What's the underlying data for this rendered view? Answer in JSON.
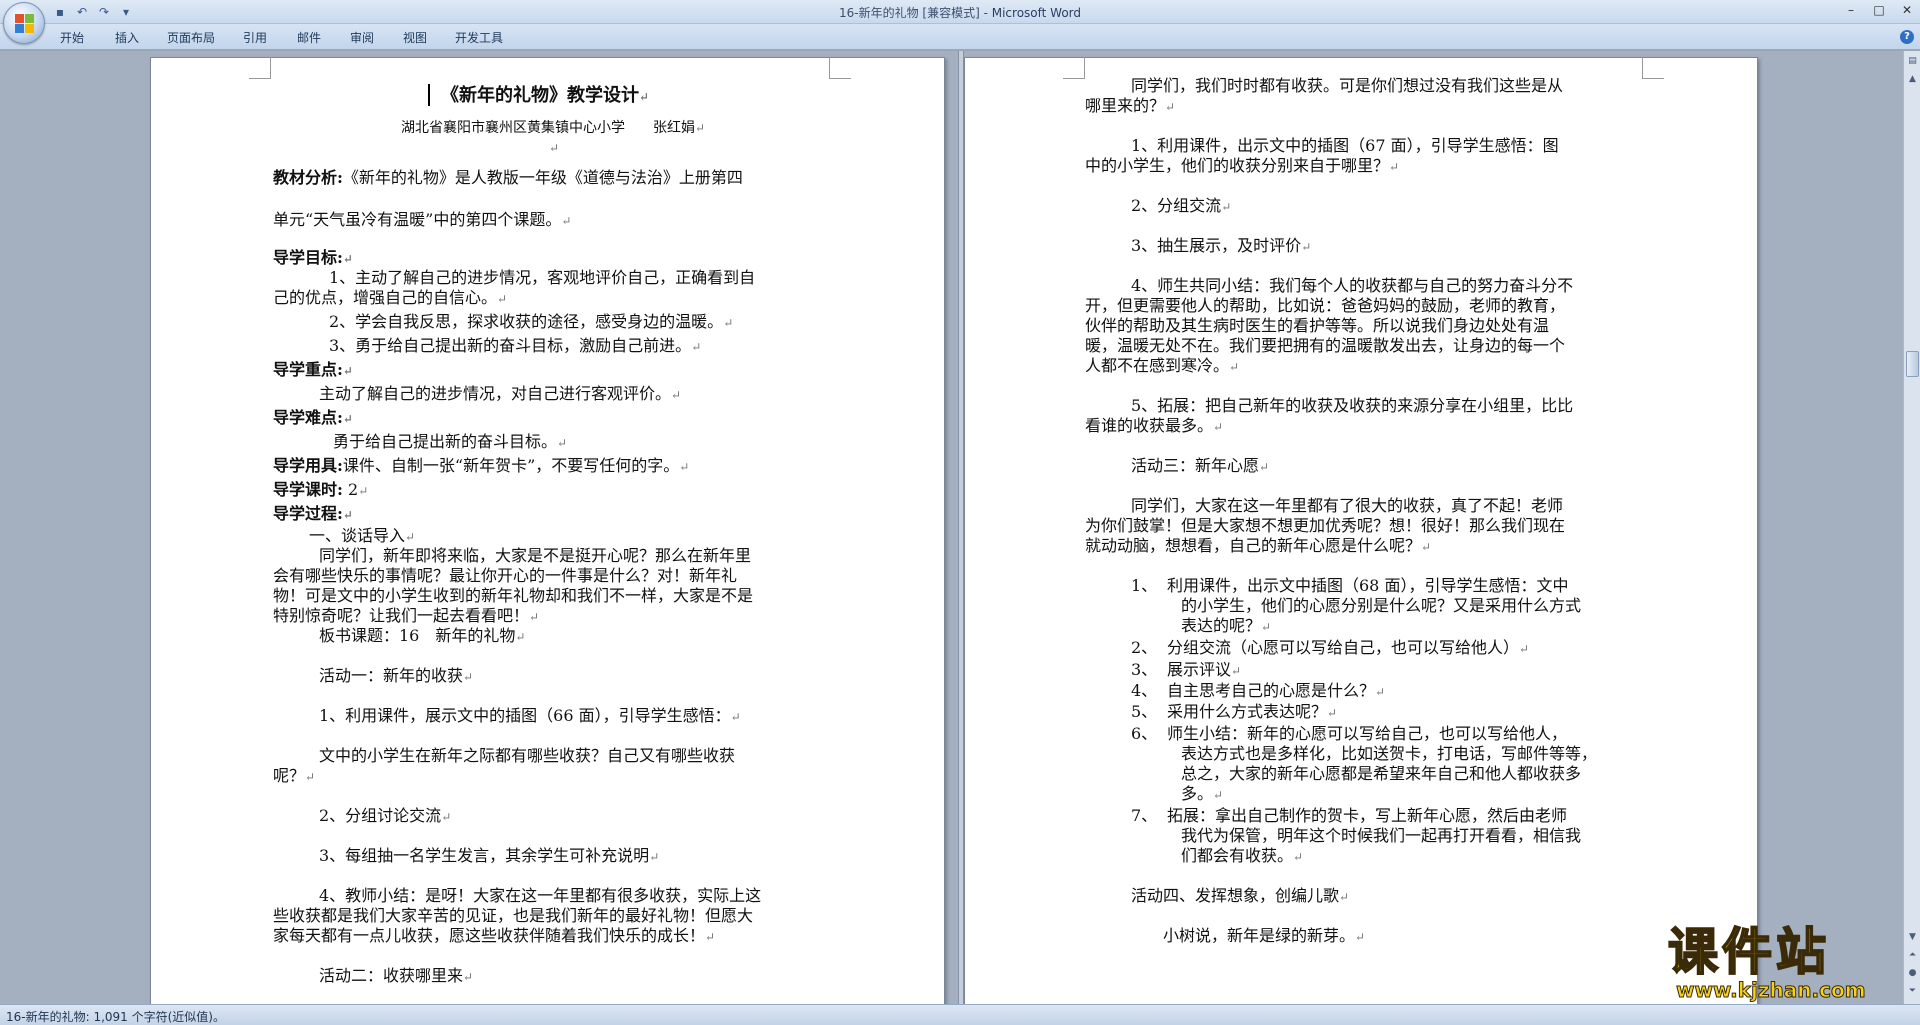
{
  "window": {
    "title": "16-新年的礼物 [兼容模式]",
    "app_name": "Microsoft Word",
    "title_separator": " - "
  },
  "quick_access": {
    "icons": [
      "save-icon",
      "undo-icon",
      "redo-icon",
      "customize-icon"
    ]
  },
  "ribbon_tabs": [
    "开始",
    "插入",
    "页面布局",
    "引用",
    "邮件",
    "审阅",
    "视图",
    "开发工具"
  ],
  "left_page": {
    "title": "《新年的礼物》教学设计",
    "author": "湖北省襄阳市襄州区黄集镇中心小学　　张红娟",
    "analysis_label": "教材分析:",
    "analysis_line1": "《新年的礼物》是人教版一年级《道德与法治》上册第四",
    "analysis_line2": "单元“天气虽冷有温暖”中的第四个课题。",
    "goals_label": "导学目标:",
    "goal1_a": "1、主动了解自己的进步情况，客观地评价自己，正确看到自",
    "goal1_b": "己的优点，增强自己的自信心。",
    "goal2": "2、学会自我反思，探求收获的途径，感受身边的温暖。",
    "goal3": "3、勇于给自己提出新的奋斗目标，激励自己前进。",
    "key_label": "导学重点:",
    "key_text": "主动了解自己的进步情况，对自己进行客观评价。",
    "hard_label": "导学难点:",
    "hard_text": "勇于给自己提出新的奋斗目标。",
    "tools_label": "导学用具:",
    "tools_text": "课件、自制一张“新年贺卡”，不要写任何的字。",
    "hours_label": "导学课时:",
    "hours_text": "2",
    "process_label": "导学过程:",
    "intro_head": "一、谈话导入",
    "intro_p1": "同学们，新年即将来临，大家是不是挺开心呢？那么在新年里",
    "intro_p2": "会有哪些快乐的事情呢？最让你开心的一件事是什么？对！新年礼",
    "intro_p3": "物！可是文中的小学生收到的新年礼物却和我们不一样，大家是不是",
    "intro_p4": "特别惊奇呢？让我们一起去看看吧！",
    "board": "板书课题：16　新年的礼物",
    "act1": "活动一：新年的收获",
    "act1_s1": "1、利用课件，展示文中的插图（66 面），引导学生感悟：",
    "act1_q1": "文中的小学生在新年之际都有哪些收获？自己又有哪些收获",
    "act1_q2": "呢？",
    "act1_s2": "2、分组讨论交流",
    "act1_s3": "3、每组抽一名学生发言，其余学生可补充说明",
    "act1_s4a": "4、教师小结：是呀！大家在这一年里都有很多收获，实际上这",
    "act1_s4b": "些收获都是我们大家辛苦的见证，也是我们新年的最好礼物！但愿大",
    "act1_s4c": "家每天都有一点儿收获，愿这些收获伴随着我们快乐的成长！",
    "act2": "活动二：收获哪里来"
  },
  "right_page": {
    "p1a": "同学们，我们时时都有收获。可是你们想过没有我们这些是从",
    "p1b": "哪里来的？",
    "s1a": "1、利用课件，出示文中的插图（67 面），引导学生感悟：图",
    "s1b": "中的小学生，他们的收获分别来自于哪里？",
    "s2": "2、分组交流",
    "s3": "3、抽生展示，及时评价",
    "s4a": "4、师生共同小结：我们每个人的收获都与自己的努力奋斗分不",
    "s4b": "开，但更需要他人的帮助，比如说：爸爸妈妈的鼓励，老师的教育，",
    "s4c": "伙伴的帮助及其生病时医生的看护等等。所以说我们身边处处有温",
    "s4d": "暖，温暖无处不在。我们要把拥有的温暖散发出去，让身边的每一个",
    "s4e": "人都不在感到寒冷。",
    "s5a": "5、拓展：把自己新年的收获及收获的来源分享在小组里，比比",
    "s5b": "看谁的收获最多。",
    "act3": "活动三：新年心愿",
    "act3_pa": "同学们，大家在这一年里都有了很大的收获，真了不起！老师",
    "act3_pb": "为你们鼓掌！但是大家想不想更加优秀呢？想！很好！那么我们现在",
    "act3_pc": "就动动脑，想想看，自己的新年心愿是什么呢？",
    "l1_num": "1、",
    "l1a": "利用课件，出示文中插图（68 面），引导学生感悟：文中",
    "l1b": "的小学生，他们的心愿分别是什么呢？又是采用什么方式",
    "l1c": "表达的呢？",
    "l2_num": "2、",
    "l2": "分组交流（心愿可以写给自己，也可以写给他人）",
    "l3_num": "3、",
    "l3": "展示评议",
    "l4_num": "4、",
    "l4": "自主思考自己的心愿是什么？",
    "l5_num": "5、",
    "l5": "采用什么方式表达呢？",
    "l6_num": "6、",
    "l6a": "师生小结：新年的心愿可以写给自己，也可以写给他人，",
    "l6b": "表达方式也是多样化，比如送贺卡，打电话，写邮件等等，",
    "l6c": "总之，大家的新年心愿都是希望来年自己和他人都收获多",
    "l6d": "多。",
    "l7_num": "7、",
    "l7a": "拓展：拿出自己制作的贺卡，写上新年心愿，然后由老师",
    "l7b": "我代为保管，明年这个时候我们一起再打开看看，相信我",
    "l7c": "们都会有收获。",
    "act4": "活动四、发挥想象，创编儿歌",
    "poem1": "小树说，新年是绿的新芽。"
  },
  "paragraph_mark": "↵",
  "status": {
    "text": "16-新年的礼物: 1,091 个字符(近似值)。"
  },
  "watermark": {
    "brand": "课件站",
    "url": "www.kjzhan.com"
  },
  "colors": {
    "ribbon_bg": "#c9d9ee",
    "workspace_bg": "#a4afc0",
    "watermark_fill": "#f5d21a"
  }
}
